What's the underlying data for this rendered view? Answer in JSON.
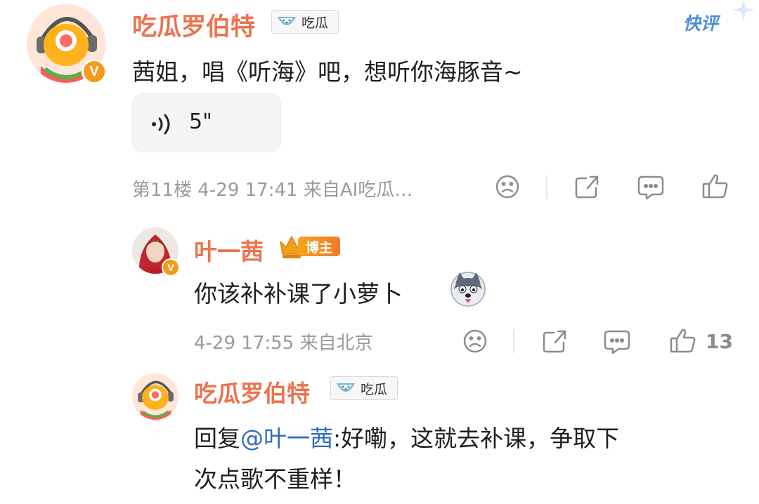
{
  "quick_comment_label": "快评",
  "comment1": {
    "author": "吃瓜罗伯特",
    "tag": "吃瓜",
    "text": "茜姐，唱《听海》吧，想听你海豚音~",
    "voice_duration": "5\"",
    "meta": "第11楼 4-29 17:41 来自AI吃瓜…",
    "verified": "V"
  },
  "reply1": {
    "author": "叶一茜",
    "badge": "博主",
    "text": "你该补补课了小萝卜",
    "meta": "4-29 17:55 来自北京",
    "like_count": "13",
    "verified": "V"
  },
  "reply2": {
    "author": "吃瓜罗伯特",
    "tag": "吃瓜",
    "text_prefix": "回复",
    "mention": "@叶一茜",
    "text_rest": ":好嘞，这就去补课，争取下",
    "text_line2": "次点歌不重样！"
  },
  "colors": {
    "author_name": "#eb7350",
    "mention": "#2f6bbd",
    "meta_gray": "#9a9a9a",
    "verified_badge": "#f59b1c"
  }
}
